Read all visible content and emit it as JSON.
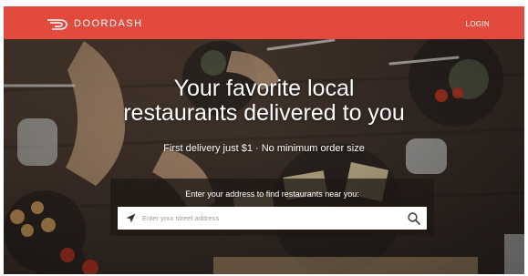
{
  "header": {
    "brand_name": "DOORDASH",
    "login_label": "LOGIN",
    "brand_color": "#e24a3d"
  },
  "hero": {
    "title_line1": "Your favorite local",
    "title_line2": "restaurants delivered to you",
    "subtitle": "First delivery just $1 · No minimum order size"
  },
  "address_search": {
    "label": "Enter your address to find restaurants near you:",
    "placeholder": "Enter your street address",
    "value": "",
    "location_icon": "location-arrow-icon",
    "search_icon": "search-icon"
  }
}
